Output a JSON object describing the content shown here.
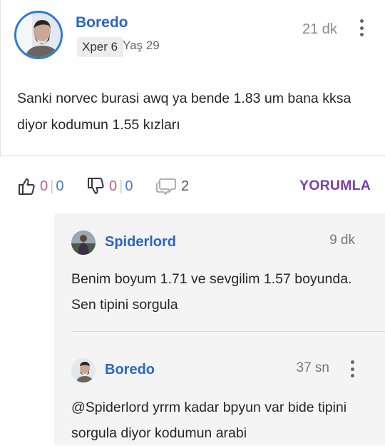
{
  "post": {
    "author": "Boredo",
    "level_badge": "Xper 6",
    "age": "Yaş 29",
    "time": "21 dk",
    "body": "Sanki norvec burasi awq ya bende 1.83 um bana kksa diyor kodumun 1.55 kızları",
    "avatar_icon": "user-avatar-photo",
    "menu_icon": "more-vertical-icon"
  },
  "actions": {
    "like_icon": "thumbs-up-icon",
    "like_count_a": "0",
    "like_count_b": "0",
    "dislike_icon": "thumbs-down-icon",
    "dislike_count_a": "0",
    "dislike_count_b": "0",
    "comment_icon": "comment-bubble-icon",
    "comment_count": "2",
    "reply_label": "YORUMLA"
  },
  "comments": [
    {
      "author": "Spiderlord",
      "time": "9 dk",
      "body": "Benim boyum 1.71 ve sevgilim 1.57 boyunda. Sen tipini sorgula"
    },
    {
      "author": "Boredo",
      "time": "37 sn",
      "body": "@Spiderlord yrrm kadar bpyun var bide tipini sorgula diyor kodumun arabi"
    }
  ],
  "colors": {
    "author_blue": "#2a66c4",
    "reply_purple": "#7b3fb0",
    "count_pink": "#c8588c",
    "count_blue": "#3a7bd5",
    "comment_bg": "#f4f4f4"
  }
}
